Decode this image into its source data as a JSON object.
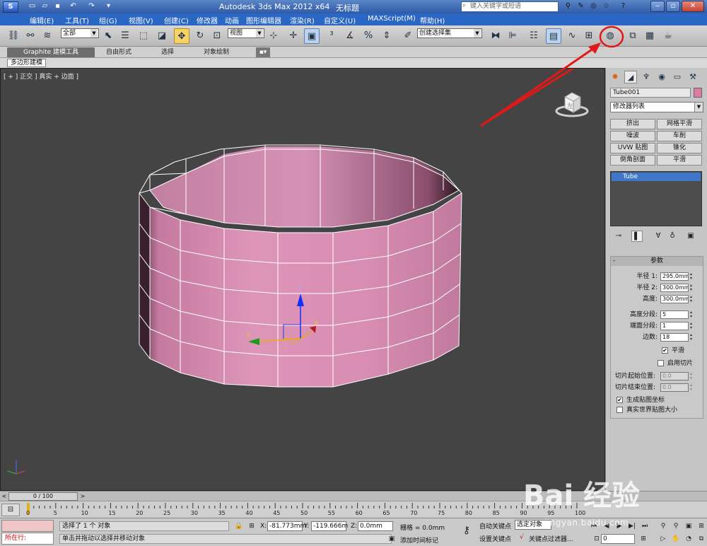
{
  "titlebar": {
    "app_title": "Autodesk 3ds Max  2012 x64",
    "file_name": "无标题",
    "search_placeholder": "键入关键字或短语",
    "logo_text": "S"
  },
  "menu": [
    "编辑(E)",
    "工具(T)",
    "组(G)",
    "视图(V)",
    "创建(C)",
    "修改器",
    "动画",
    "图形编辑器",
    "渲染(R)",
    "自定义(U)",
    "MAXScript(M)",
    "帮助(H)"
  ],
  "toolbar": {
    "selection_filter": "全部",
    "ref_coord": "视图",
    "named_selection": "创建选择集"
  },
  "ribbon": {
    "tabs": [
      "Graphite 建模工具",
      "自由形式",
      "选择",
      "对象绘制"
    ],
    "sub_label": "多边形建模"
  },
  "viewport": {
    "label": "[ + ] 正交 ] 真实 + 边面 ]",
    "viewcube_face": "左",
    "mesh_color": "#d98fb3",
    "edge_color": "#ffffff",
    "annotation_color": "#e01818"
  },
  "command_panel": {
    "object_name": "Tube001",
    "object_color": "#e07aa3",
    "modifier_list": "修改器列表",
    "modifier_buttons": [
      "挤出",
      "网格平滑",
      "噪波",
      "车削",
      "UVW 贴图",
      "锥化",
      "倒角剖面",
      "平滑"
    ],
    "stack_item": "Tube",
    "rollout_title": "参数",
    "params": [
      {
        "label": "半径 1:",
        "value": "295.0mm"
      },
      {
        "label": "半径 2:",
        "value": "300.0mm"
      },
      {
        "label": "高度:",
        "value": "300.0mm"
      },
      {
        "label": "高度分段:",
        "value": "5"
      },
      {
        "label": "端面分段:",
        "value": "1"
      },
      {
        "label": "边数:",
        "value": "18"
      }
    ],
    "smooth_label": "平滑",
    "slice_on_label": "启用切片",
    "slice_from_label": "切片起始位置:",
    "slice_from_value": "0.0",
    "slice_to_label": "切片结束位置:",
    "slice_to_value": "0.0",
    "gen_mapping_label": "生成贴图坐标",
    "real_world_label": "真实世界贴图大小"
  },
  "timeline": {
    "slider_text": "0 / 100",
    "ticks": [
      "0",
      "5",
      "10",
      "15",
      "20",
      "25",
      "30",
      "35",
      "40",
      "45",
      "50",
      "55",
      "60",
      "65",
      "70",
      "75",
      "80",
      "85",
      "90",
      "95",
      "100"
    ]
  },
  "status": {
    "listener_text": "所在行:",
    "message1": "选择了 1 个 对象",
    "message2": "单击并拖动以选择并移动对象",
    "x_label": "X:",
    "x_value": "-81.773mm",
    "y_label": "Y:",
    "y_value": "-119.666m",
    "z_label": "Z:",
    "z_value": "0.0mm",
    "grid": "栅格 = 0.0mm",
    "add_time_tag": "添加时间标记",
    "auto_key": "自动关键点",
    "selected_obj": "选定对象",
    "set_key": "设置关键点",
    "key_filters": "关键点过滤器...",
    "frame": "0"
  },
  "watermark": {
    "logo": "Bai 经验",
    "url": "jingyan.baidu.com"
  }
}
